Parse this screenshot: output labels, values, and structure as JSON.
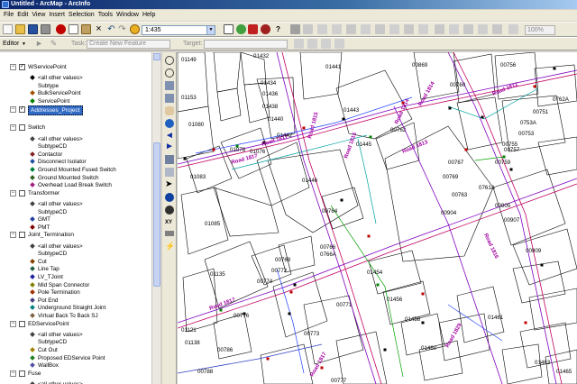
{
  "window": {
    "title": "Untitled - ArcMap - ArcInfo"
  },
  "menus": [
    "File",
    "Edit",
    "View",
    "Insert",
    "Selection",
    "Tools",
    "Window",
    "Help"
  ],
  "toolbar": {
    "scale": "1:435",
    "zoom": "100%"
  },
  "editor": {
    "editor_label": "Editor",
    "task_label": "Task:",
    "task_value": "Create New Feature",
    "target_label": "Target:"
  },
  "toc": {
    "rows": [
      {
        "type": "layer",
        "label": "WServicePoint",
        "checked": true,
        "indent": 0
      },
      {
        "type": "class",
        "label": "<all other values>",
        "color": "#000000",
        "shape": "dot"
      },
      {
        "type": "heading",
        "label": "Subtype"
      },
      {
        "type": "class",
        "label": "BulkServicePoint",
        "color": "#a05000",
        "shape": "dot"
      },
      {
        "type": "class",
        "label": "ServicePoint",
        "color": "#008000",
        "shape": "dot"
      },
      {
        "type": "layer",
        "label": "Addresses_Project",
        "checked": true,
        "selected": true
      },
      {
        "type": "blank"
      },
      {
        "type": "layer",
        "label": "Switch",
        "checked": false
      },
      {
        "type": "class",
        "label": "<all other values>",
        "color": "#404040",
        "shape": "dot"
      },
      {
        "type": "heading",
        "label": "SubtypeCD"
      },
      {
        "type": "class",
        "label": "Contactor",
        "color": "#802020",
        "shape": "dot"
      },
      {
        "type": "class",
        "label": "Disconnect Isolator",
        "color": "#2050a0",
        "shape": "dot"
      },
      {
        "type": "class",
        "label": "Ground Mounted Fused Switch",
        "color": "#008040",
        "shape": "dot"
      },
      {
        "type": "class",
        "label": "Ground Mounted Switch",
        "color": "#306020",
        "shape": "dot"
      },
      {
        "type": "class",
        "label": "Overhead Load Break Switch",
        "color": "#a02080",
        "shape": "dot"
      },
      {
        "type": "layer",
        "label": "Transformer",
        "checked": false
      },
      {
        "type": "class",
        "label": "<all other values>",
        "color": "#404040",
        "shape": "dot"
      },
      {
        "type": "heading",
        "label": "SubtypeCD"
      },
      {
        "type": "class",
        "label": "GMT",
        "color": "#2040a0",
        "shape": "dot"
      },
      {
        "type": "class",
        "label": "PMT",
        "color": "#800000",
        "shape": "dot"
      },
      {
        "type": "layer",
        "label": "Joint_Termination",
        "checked": false
      },
      {
        "type": "class",
        "label": "<all other values>",
        "color": "#404040",
        "shape": "dot"
      },
      {
        "type": "heading",
        "label": "SubtypeCD"
      },
      {
        "type": "class",
        "label": "Cut",
        "color": "#804000",
        "shape": "dot"
      },
      {
        "type": "class",
        "label": "Line Tap",
        "color": "#206040",
        "shape": "dot"
      },
      {
        "type": "class",
        "label": "LV_TJoint",
        "color": "#2020a0",
        "shape": "dot"
      },
      {
        "type": "class",
        "label": "Mid Span Connector",
        "color": "#808000",
        "shape": "dot"
      },
      {
        "type": "class",
        "label": "Pole Termination",
        "color": "#a03000",
        "shape": "dot"
      },
      {
        "type": "class",
        "label": "Pot End",
        "color": "#404080",
        "shape": "dot"
      },
      {
        "type": "class",
        "label": "Underground Straight Joint",
        "color": "#008080",
        "shape": "dot"
      },
      {
        "type": "class",
        "label": "Virtual Back To Back SJ",
        "color": "#806040",
        "shape": "dot"
      },
      {
        "type": "layer",
        "label": "EDServicePoint",
        "checked": false
      },
      {
        "type": "class",
        "label": "<all other values>",
        "color": "#404040",
        "shape": "dot"
      },
      {
        "type": "heading",
        "label": "SubtypeCD"
      },
      {
        "type": "class",
        "label": "Cut Out",
        "color": "#a08000",
        "shape": "dot"
      },
      {
        "type": "class",
        "label": "Proposed EDService Point",
        "color": "#208020",
        "shape": "dot"
      },
      {
        "type": "class",
        "label": "WallBox",
        "color": "#5050a0",
        "shape": "dot"
      },
      {
        "type": "layer",
        "label": "Fuse",
        "checked": false
      },
      {
        "type": "class",
        "label": "<all other values>",
        "color": "#404040",
        "shape": "dot"
      }
    ]
  },
  "map": {
    "parcel_labels": [
      {
        "t": "01149"
      },
      {
        "t": "01432"
      },
      {
        "t": "01434"
      },
      {
        "t": "01436"
      },
      {
        "t": "01438"
      },
      {
        "t": "01440"
      },
      {
        "t": "01442"
      },
      {
        "t": "01441"
      },
      {
        "t": "01443"
      },
      {
        "t": "01445"
      },
      {
        "t": "01153"
      },
      {
        "t": "01080"
      },
      {
        "t": "01078"
      },
      {
        "t": "01076"
      },
      {
        "t": "01083"
      },
      {
        "t": "01085"
      },
      {
        "t": "01446"
      },
      {
        "t": "00764"
      },
      {
        "t": "00766"
      },
      {
        "t": "0766A"
      },
      {
        "t": "00768"
      },
      {
        "t": "00772"
      },
      {
        "t": "00774"
      },
      {
        "t": "01135"
      },
      {
        "t": "00776"
      },
      {
        "t": "01121"
      },
      {
        "t": "01138"
      },
      {
        "t": "00786"
      },
      {
        "t": "00788"
      },
      {
        "t": "00771"
      },
      {
        "t": "00773"
      },
      {
        "t": "00777"
      },
      {
        "t": "01454"
      },
      {
        "t": "01456"
      },
      {
        "t": "01458"
      },
      {
        "t": "01460"
      },
      {
        "t": "01461"
      },
      {
        "t": "00904"
      },
      {
        "t": "00905"
      },
      {
        "t": "00907"
      },
      {
        "t": "00909"
      },
      {
        "t": "00869"
      },
      {
        "t": "00756"
      },
      {
        "t": "00760"
      },
      {
        "t": "00762"
      },
      {
        "t": "0762A"
      },
      {
        "t": "00751"
      },
      {
        "t": "0753A"
      },
      {
        "t": "00753"
      },
      {
        "t": "00755"
      },
      {
        "t": "00757"
      },
      {
        "t": "00759"
      },
      {
        "t": "0761A"
      },
      {
        "t": "00763"
      },
      {
        "t": "00767"
      },
      {
        "t": "00769"
      },
      {
        "t": "01463"
      },
      {
        "t": "01465"
      }
    ],
    "road_labels": [
      {
        "t": "Road 1815"
      },
      {
        "t": "Road 1815"
      },
      {
        "t": "Road 1814"
      },
      {
        "t": "Road 1812"
      },
      {
        "t": "Road 1813"
      },
      {
        "t": "Road 1817"
      },
      {
        "t": "Road 1817"
      },
      {
        "t": "Road 1814"
      },
      {
        "t": "Road 1816"
      },
      {
        "t": "Road 1817"
      },
      {
        "t": "Road 1829"
      },
      {
        "t": "Road 1817"
      }
    ]
  }
}
